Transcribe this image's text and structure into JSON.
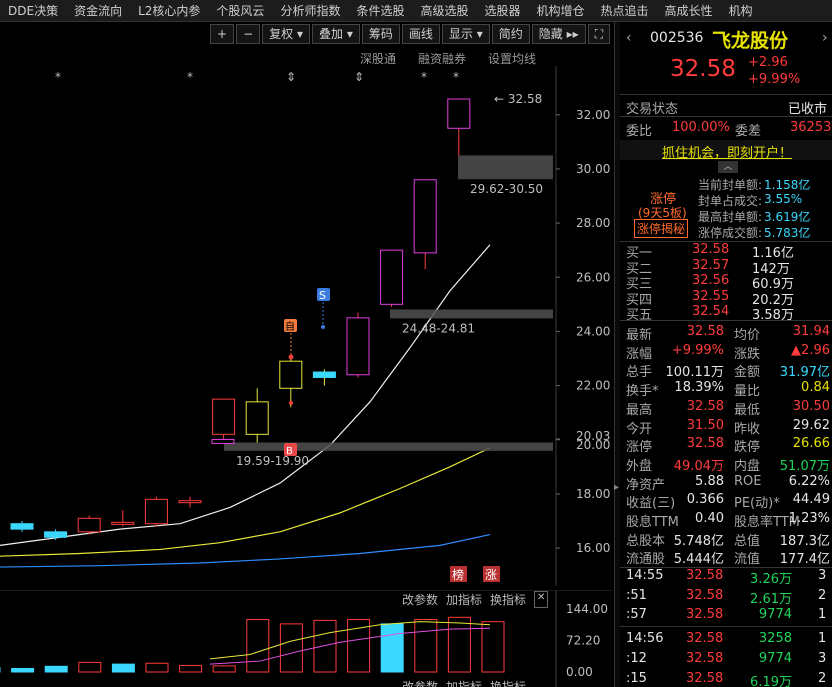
{
  "menu": [
    "DDE决策",
    "资金流向",
    "L2核心内参",
    "个股风云",
    "分析师指数",
    "条件选股",
    "高级选股",
    "选股器",
    "机构增仓",
    "热点追击",
    "高成长性",
    "机构"
  ],
  "toolbar": [
    "+",
    "−",
    "复权",
    "叠加",
    "筹码",
    "画线",
    "显示",
    "简约",
    "隐藏",
    "⛶"
  ],
  "subtools": [
    "深股通",
    "融资融券",
    "设置均线"
  ],
  "chart_data": {
    "type": "candlestick",
    "y_ticks": [
      "32.00",
      "30.00",
      "28.00",
      "26.00",
      "24.00",
      "22.00",
      "20.03",
      "20.00",
      "18.00",
      "16.00"
    ],
    "ylim": [
      14.6,
      33.8
    ],
    "last_price_label": "32.58",
    "gaps": [
      {
        "label": "29.62-30.50",
        "low": 29.62,
        "high": 30.5
      },
      {
        "label": "24.48-24.81",
        "low": 24.48,
        "high": 24.81
      },
      {
        "label": "19.59-19.90",
        "low": 19.59,
        "high": 19.9
      }
    ],
    "candles": [
      {
        "o": 16.9,
        "c": 16.7,
        "h": 17.0,
        "l": 16.6
      },
      {
        "o": 16.6,
        "c": 16.4,
        "h": 16.7,
        "l": 16.3
      },
      {
        "o": 16.6,
        "c": 17.1,
        "h": 17.2,
        "l": 16.5
      },
      {
        "o": 16.9,
        "c": 16.95,
        "h": 17.4,
        "l": 16.8
      },
      {
        "o": 16.9,
        "c": 17.8,
        "h": 17.9,
        "l": 16.8
      },
      {
        "o": 17.7,
        "c": 17.75,
        "h": 17.9,
        "l": 17.5
      },
      {
        "o": 20.2,
        "c": 21.5,
        "h": 21.5,
        "l": 19.9
      },
      {
        "o": 20.2,
        "c": 21.4,
        "h": 21.9,
        "l": 19.9
      },
      {
        "o": 22.9,
        "c": 21.9,
        "h": 23.0,
        "l": 21.2
      },
      {
        "o": 22.5,
        "c": 22.3,
        "h": 22.6,
        "l": 22.0
      },
      {
        "o": 22.4,
        "c": 24.5,
        "h": 24.7,
        "l": 22.3
      },
      {
        "o": 25.0,
        "c": 27.0,
        "h": 27.0,
        "l": 24.9
      },
      {
        "o": 26.9,
        "c": 29.6,
        "h": 29.6,
        "l": 26.3
      },
      {
        "o": 31.5,
        "c": 32.58,
        "h": 32.58,
        "l": 30.5
      }
    ],
    "volume_ticks": [
      "144.00",
      "72.20",
      "0.00"
    ],
    "volume_ylim": [
      0,
      160
    ],
    "volumes": [
      10,
      8,
      13,
      22,
      18,
      20,
      15,
      14,
      120,
      110,
      118,
      120,
      110,
      120,
      125,
      115
    ],
    "volume_colors": [
      "cyan",
      "cyan",
      "cyan",
      "red",
      "cyan",
      "red",
      "red",
      "red",
      "red",
      "red",
      "red",
      "red",
      "cyan",
      "red",
      "red",
      "red"
    ]
  },
  "chart_icons": {
    "stars": [
      "*",
      "*",
      "*",
      "*",
      "*"
    ],
    "arrows": [
      "⇕",
      "⇕"
    ],
    "s_marker": "S",
    "zi_marker": "自",
    "b_marker": "B",
    "bang": "榜",
    "zhang": "涨"
  },
  "vol_tools": [
    "改参数",
    "加指标",
    "换指标",
    "✕"
  ],
  "vol_tools_bottom": [
    "改参数",
    "加指标",
    "换指标"
  ],
  "stock": {
    "code": "002536",
    "name": "飞龙股份",
    "price": "32.58",
    "change": "+2.96",
    "change_pct": "+9.99%"
  },
  "trade_status": {
    "label": "交易状态",
    "value": "已收市"
  },
  "commission": {
    "ratio_label": "委比",
    "ratio": "100.00%",
    "diff_label": "委差",
    "diff": "36253"
  },
  "promo": "抓住机会，即刻开户！",
  "limit": {
    "tag": "涨停",
    "days": "(9天5板)",
    "secret": "涨停揭秘",
    "items": [
      {
        "label": "当前封单额:",
        "value": "1.158亿"
      },
      {
        "label": "封单占成交:",
        "value": "3.55%"
      },
      {
        "label": "最高封单额:",
        "value": "3.619亿"
      },
      {
        "label": "涨停成交额:",
        "value": "5.783亿"
      }
    ]
  },
  "bids": [
    {
      "label": "买一",
      "price": "32.58",
      "vol": "1.16亿"
    },
    {
      "label": "买二",
      "price": "32.57",
      "vol": "142万"
    },
    {
      "label": "买三",
      "price": "32.56",
      "vol": "60.9万"
    },
    {
      "label": "买四",
      "price": "32.55",
      "vol": "20.2万"
    },
    {
      "label": "买五",
      "price": "32.54",
      "vol": "3.58万"
    }
  ],
  "stats": [
    {
      "l1": "最新",
      "v1": "32.58",
      "c1": "red",
      "l2": "均价",
      "v2": "31.94",
      "c2": "red"
    },
    {
      "l1": "涨幅",
      "v1": "+9.99%",
      "c1": "red",
      "l2": "涨跌",
      "v2": "▲2.96",
      "c2": "red"
    },
    {
      "l1": "总手",
      "v1": "100.11万",
      "c1": "white",
      "l2": "金额",
      "v2": "31.97亿",
      "c2": "cyan"
    },
    {
      "l1": "换手*",
      "v1": "18.39%",
      "c1": "white",
      "l2": "量比",
      "v2": "0.84",
      "c2": "yellow"
    },
    {
      "l1": "最高",
      "v1": "32.58",
      "c1": "red",
      "l2": "最低",
      "v2": "30.50",
      "c2": "red"
    },
    {
      "l1": "今开",
      "v1": "31.50",
      "c1": "red",
      "l2": "昨收",
      "v2": "29.62",
      "c2": "white"
    },
    {
      "l1": "涨停",
      "v1": "32.58",
      "c1": "red",
      "l2": "跌停",
      "v2": "26.66",
      "c2": "yellow"
    },
    {
      "l1": "外盘",
      "v1": "49.04万",
      "c1": "red",
      "l2": "内盘",
      "v2": "51.07万",
      "c2": "green"
    },
    {
      "l1": "净资产",
      "v1": "5.88",
      "c1": "white",
      "l2": "ROE",
      "v2": "6.22%",
      "c2": "white"
    },
    {
      "l1": "收益(三)",
      "v1": "0.366",
      "c1": "white",
      "l2": "PE(动)*",
      "v2": "44.49",
      "c2": "white"
    },
    {
      "l1": "股息TTM",
      "v1": "0.40",
      "c1": "white",
      "l2": "股息率TTM",
      "v2": "1.23%",
      "c2": "white"
    },
    {
      "l1": "总股本",
      "v1": "5.748亿",
      "c1": "white",
      "l2": "总值",
      "v2": "187.3亿",
      "c2": "white"
    },
    {
      "l1": "流通股",
      "v1": "5.444亿",
      "c1": "white",
      "l2": "流值",
      "v2": "177.4亿",
      "c2": "white"
    }
  ],
  "ticks": [
    {
      "time": "14:55",
      "price": "32.58",
      "vol": "3.26万",
      "n": "3"
    },
    {
      "time": ":51",
      "price": "32.58",
      "vol": "2.61万",
      "n": "2"
    },
    {
      "time": ":57",
      "price": "32.58",
      "vol": "9774",
      "n": "1"
    },
    {
      "time": "14:56",
      "price": "32.58",
      "vol": "3258",
      "n": "1"
    },
    {
      "time": ":12",
      "price": "32.58",
      "vol": "9774",
      "n": "3"
    },
    {
      "time": ":15",
      "price": "32.58",
      "vol": "6.19万",
      "n": "2"
    }
  ],
  "colors": {
    "up": "#ff3b3b",
    "down": "#1fd45a",
    "cyan": "#3ad8ff",
    "ma_white": "#f0f0f0",
    "ma_yellow": "#e8e83a",
    "ma_blue": "#2f8cff",
    "vol_magenta": "#e050e0"
  }
}
